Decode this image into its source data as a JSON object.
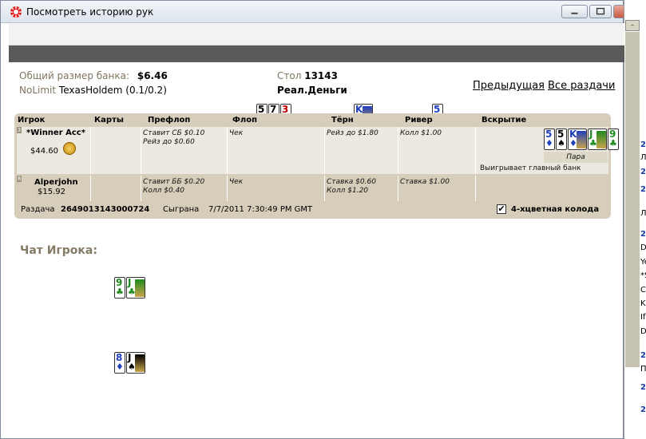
{
  "window": {
    "title": "Посмотреть историю рук"
  },
  "background_app": {
    "lines": [
      {
        "text": "22",
        "style": "blue"
      },
      {
        "text": "Л",
        "style": "normal"
      },
      {
        "text": "22",
        "style": "blue"
      },
      {
        "text": "22",
        "style": "blue"
      },
      {
        "text": "Л",
        "style": "normal"
      },
      {
        "text": "22",
        "style": "blue"
      },
      {
        "text": "Du",
        "style": "normal"
      },
      {
        "text": "Ye",
        "style": "normal"
      },
      {
        "text": "*S",
        "style": "normal"
      },
      {
        "text": "Ca",
        "style": "normal"
      },
      {
        "text": "Ka",
        "style": "normal"
      },
      {
        "text": "If",
        "style": "normal"
      },
      {
        "text": "Da",
        "style": "normal"
      },
      {
        "text": "22",
        "style": "blue"
      },
      {
        "text": "П",
        "style": "normal"
      },
      {
        "text": "22",
        "style": "blue"
      },
      {
        "text": "22",
        "style": "blue"
      }
    ]
  },
  "header": {
    "pot_label": "Общий размер банка:",
    "pot_value": "$6.46",
    "game_limit": "NoLimit",
    "game_name": "TexasHoldem",
    "game_stakes": "(0.1/0.2)",
    "table_label": "Стол",
    "table_value": "13143",
    "money_type": "Реал.Деньги",
    "prev_link": "Предыдущая",
    "all_hands_link": "Все раздачи"
  },
  "columns": {
    "player": "Игрок",
    "cards": "Карты",
    "preflop": "Префлоп",
    "flop": "Флоп",
    "turn": "Тёрн",
    "river": "Ривер",
    "showdown": "Вскрытие"
  },
  "board": {
    "flop": [
      {
        "rank": "5",
        "suit": "♠",
        "color": "black"
      },
      {
        "rank": "7",
        "suit": "♠",
        "color": "black"
      },
      {
        "rank": "3",
        "suit": "♥",
        "color": "red"
      }
    ],
    "turn": [
      {
        "rank": "K",
        "suit": "♦",
        "color": "blue"
      }
    ],
    "river": [
      {
        "rank": "5",
        "suit": "♦",
        "color": "blue"
      }
    ]
  },
  "players": [
    {
      "seat": "3",
      "name": "*Winner Acc*",
      "stack": "$44.60",
      "cards": [
        {
          "rank": "9",
          "suit": "♣",
          "color": "green"
        },
        {
          "rank": "J",
          "suit": "♣",
          "color": "green"
        }
      ],
      "preflop": [
        "Ставит СБ $0.10",
        "Рейз до $0.60"
      ],
      "flop": [
        "Чек"
      ],
      "turn": [
        "Рейз до $1.80"
      ],
      "river": [
        "Колл $1.00"
      ],
      "showdown_cards": [
        {
          "rank": "5",
          "suit": "♦",
          "color": "blue"
        },
        {
          "rank": "5",
          "suit": "♠",
          "color": "black"
        },
        {
          "rank": "K",
          "suit": "♦",
          "color": "blue"
        },
        {
          "rank": "J",
          "suit": "♣",
          "color": "green"
        },
        {
          "rank": "9",
          "suit": "♣",
          "color": "green"
        }
      ],
      "hand_rank": "Пара",
      "result": "Выигрывает главный банк"
    },
    {
      "seat": "8",
      "name": "Alperjohn",
      "stack": "$15.92",
      "cards": [
        {
          "rank": "8",
          "suit": "♦",
          "color": "blue"
        },
        {
          "rank": "J",
          "suit": "♠",
          "color": "black"
        }
      ],
      "preflop": [
        "Ставит ББ $0.20",
        "Колл $0.40"
      ],
      "flop": [
        "Чек"
      ],
      "turn": [
        "Ставка $0.60",
        "Колл $1.20"
      ],
      "river": [
        "Ставка $1.00"
      ]
    }
  ],
  "footer": {
    "hand_label": "Раздача",
    "hand_id": "2649013143000724",
    "played_label": "Сыграна",
    "played_at": "7/7/2011 7:30:49 PM GMT",
    "four_color_checked": true,
    "four_color_label": "4-хцветная колода"
  },
  "chat": {
    "title": "Чат Игрока:"
  },
  "colors": {
    "black": "#000000",
    "red": "#c00000",
    "blue": "#1f3fbf",
    "green": "#1e8a1e",
    "table_bg": "#d6ceba",
    "label_text": "#807560"
  }
}
